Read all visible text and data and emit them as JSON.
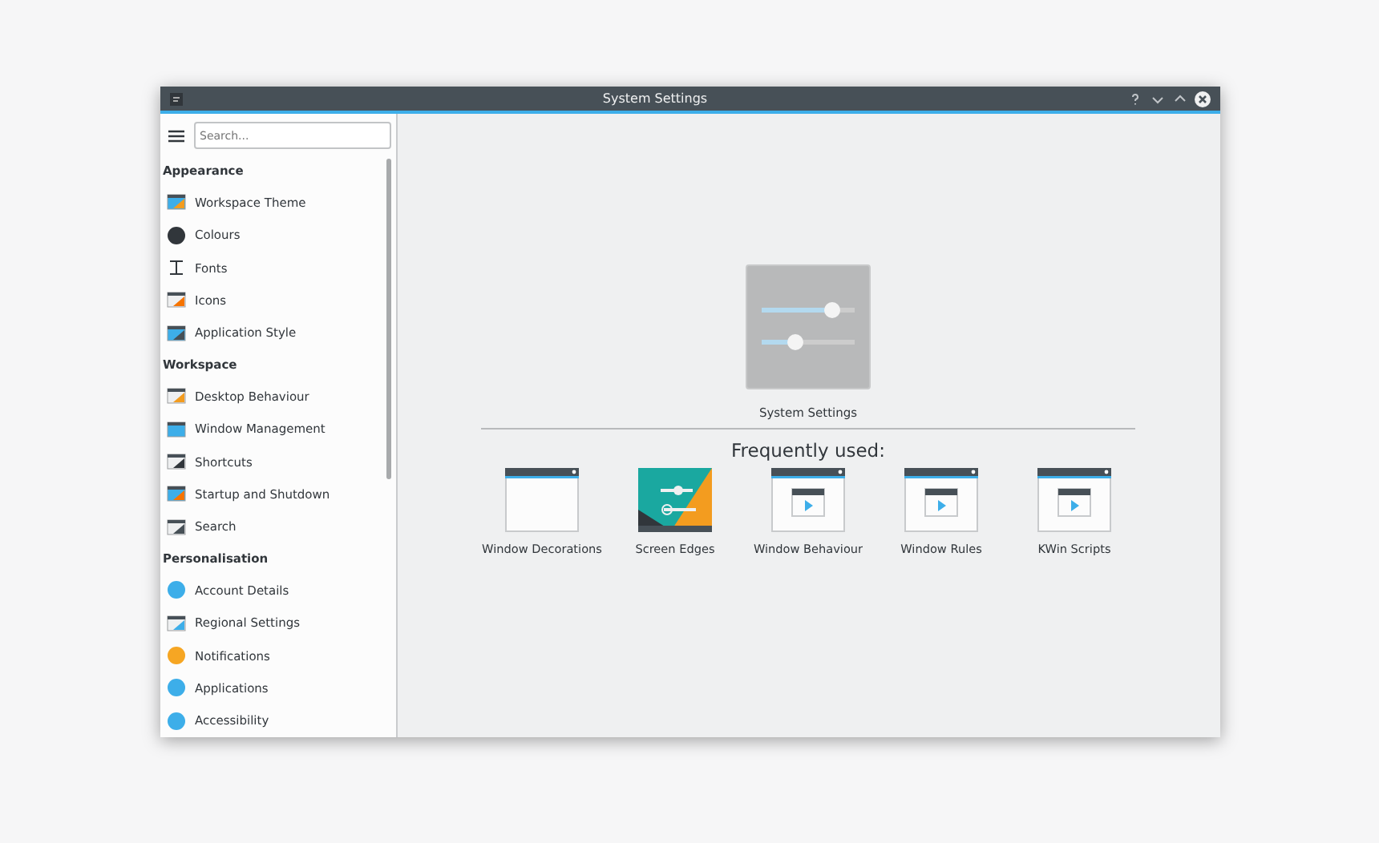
{
  "window": {
    "title": "System Settings"
  },
  "search": {
    "placeholder": "Search..."
  },
  "sidebar": {
    "sections": [
      {
        "title": "Appearance",
        "items": [
          "Workspace Theme",
          "Colours",
          "Fonts",
          "Icons",
          "Application Style"
        ]
      },
      {
        "title": "Workspace",
        "items": [
          "Desktop Behaviour",
          "Window Management",
          "Shortcuts",
          "Startup and Shutdown",
          "Search"
        ]
      },
      {
        "title": "Personalisation",
        "items": [
          "Account Details",
          "Regional Settings",
          "Notifications",
          "Applications",
          "Accessibility"
        ]
      }
    ]
  },
  "hero": {
    "label": "System Settings"
  },
  "frequent": {
    "title": "Frequently used:",
    "items": [
      {
        "label": "Window Decorations",
        "kind": "plain"
      },
      {
        "label": "Screen Edges",
        "kind": "edges"
      },
      {
        "label": "Window Behaviour",
        "kind": "play"
      },
      {
        "label": "Window Rules",
        "kind": "play"
      },
      {
        "label": "KWin Scripts",
        "kind": "play"
      }
    ]
  }
}
